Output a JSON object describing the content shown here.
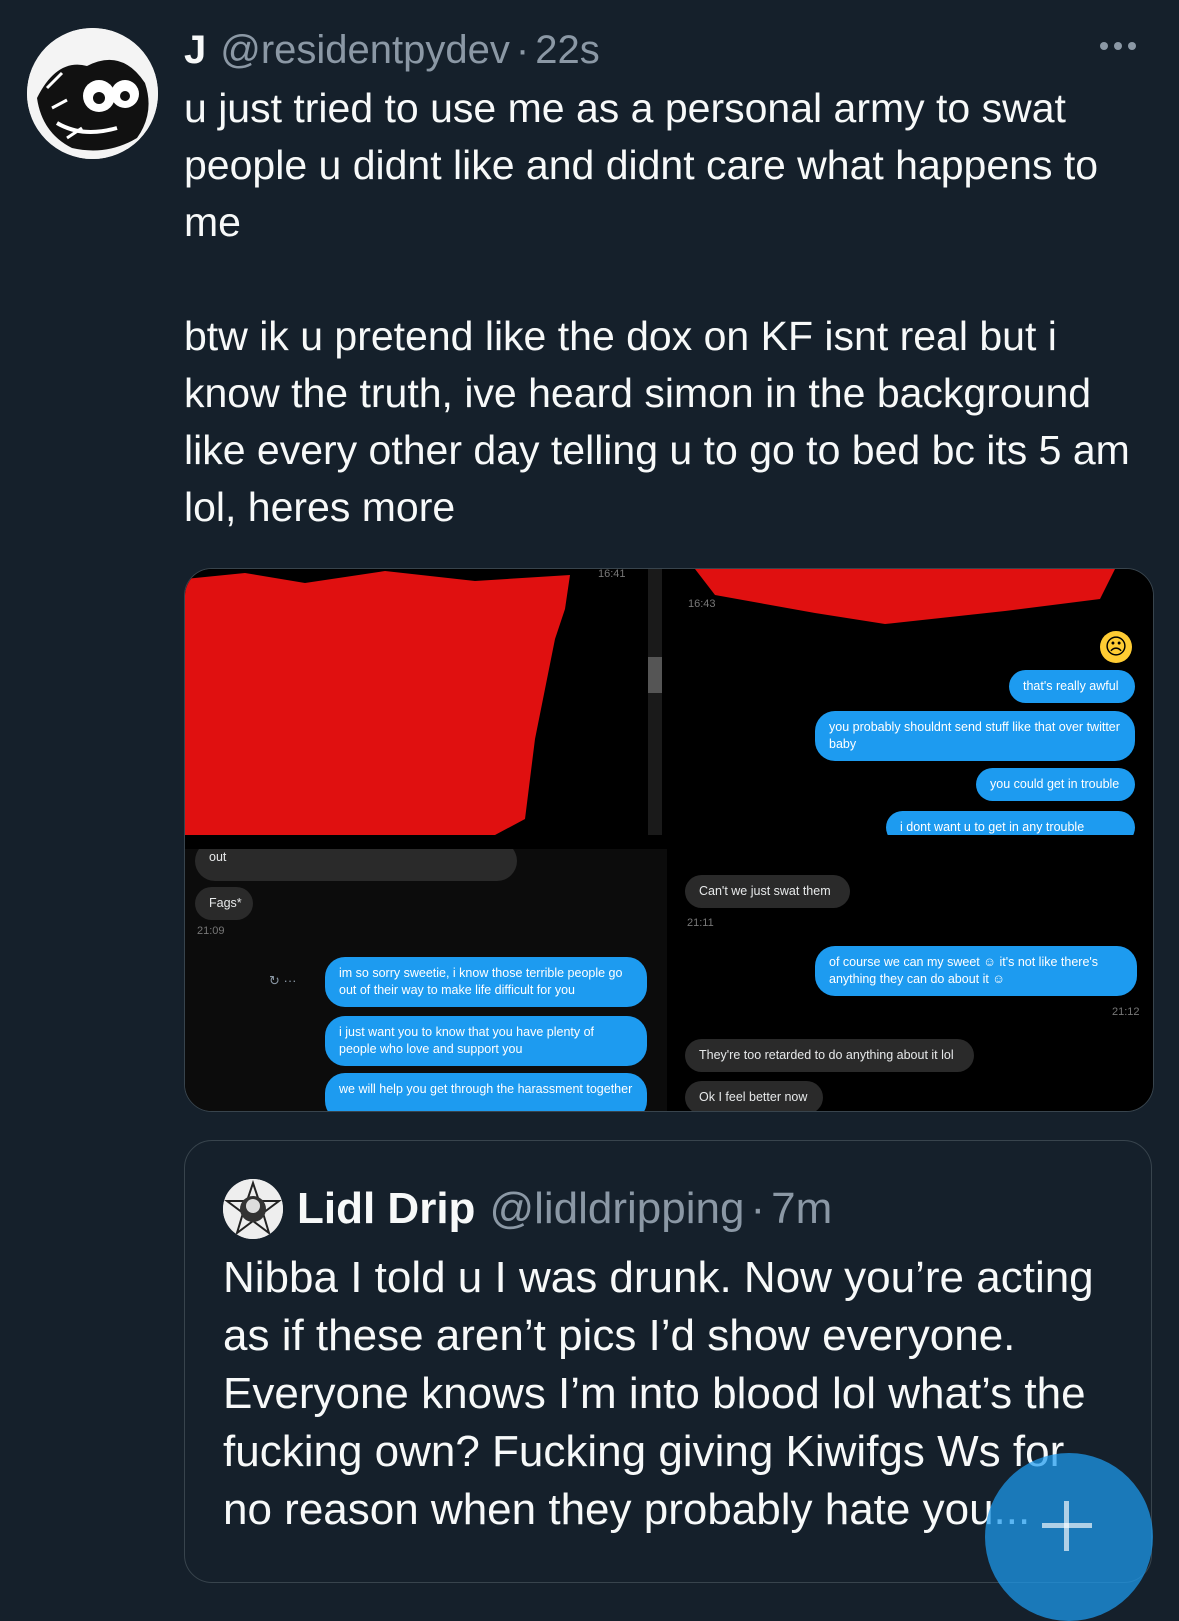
{
  "tweet": {
    "display_name": "J",
    "handle": "@residentpydev",
    "separator": "·",
    "time": "22s",
    "text": "u just tried to use me as a personal army to swat people u didnt like and didnt care what happens to me\n\nbtw ik u pretend like the dox on KF isnt real but i know the truth, ive heard simon in the background like every other day telling u to go to bed bc its 5 am lol, heres more"
  },
  "media": {
    "panel1": {
      "time": "16:41"
    },
    "panel2": {
      "time": "16:43",
      "messages": [
        "that's really awful",
        "you probably shouldnt send stuff like that over twitter baby",
        "you could get in trouble",
        "i dont want u to get in any trouble"
      ]
    },
    "panel3": {
      "messages_grey": [
        "out",
        "Fags*"
      ],
      "time": "21:09",
      "messages_blue": [
        "im so sorry sweetie, i know those terrible people go out of their way to make life difficult for you",
        "i just want you to know that you have plenty of people who love and support you",
        "we will help you get through the harassment together"
      ]
    },
    "panel4": {
      "msg1": "Can't we just swat them",
      "time1": "21:11",
      "msg2": "of course we can my sweet ☺ it's not like there's anything they can do about it ☺",
      "time2": "21:12",
      "msg3": "They're too retarded to do anything about it lol",
      "msg4": "Ok I feel better now"
    }
  },
  "quote": {
    "display_name": "Lidl Drip",
    "handle": "@lidldripping",
    "separator": "·",
    "time": "7m",
    "text": "Nibba I told u I was drunk. Now you’re acting as if these aren’t pics I’d show everyone. Everyone knows I’m into blood lol what’s the fucking own? Fucking giving Kiwifgs Ws for no reason when they probably hate you..."
  },
  "colors": {
    "background": "#15202b",
    "accent": "#1d9bf0",
    "secondary_text": "#8b98a5",
    "redaction": "#e01010"
  }
}
